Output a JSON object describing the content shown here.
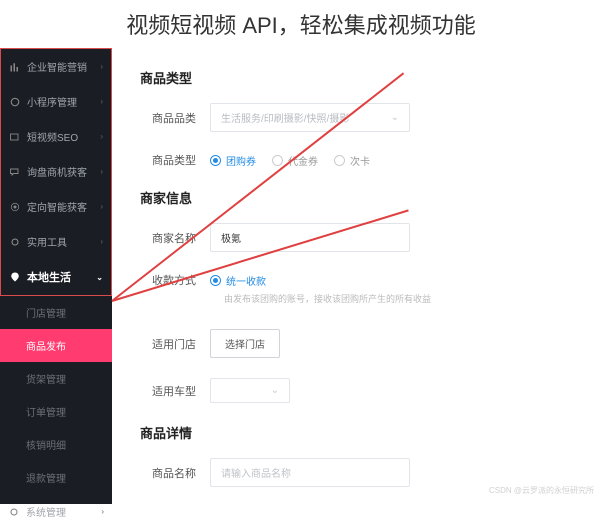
{
  "page_title": "视频短视频 API，轻松集成视频功能",
  "sidebar": {
    "items": [
      {
        "icon": "bars-icon",
        "label": "企业智能营销"
      },
      {
        "icon": "cube-icon",
        "label": "小程序管理"
      },
      {
        "icon": "seo-icon",
        "label": "短视频SEO"
      },
      {
        "icon": "chat-icon",
        "label": "询盘商机获客"
      },
      {
        "icon": "target-icon",
        "label": "定向智能获客"
      },
      {
        "icon": "gear-icon",
        "label": "实用工具"
      },
      {
        "icon": "location-icon",
        "label": "本地生活"
      }
    ],
    "sub_items": [
      "门店管理",
      "商品发布",
      "货架管理",
      "订单管理",
      "核销明细",
      "退款管理"
    ],
    "selected_sub": "商品发布",
    "bottom_item": {
      "icon": "gear-icon",
      "label": "系统管理"
    }
  },
  "sections": {
    "product_type": {
      "title": "商品类型"
    },
    "merchant_info": {
      "title": "商家信息"
    },
    "product_detail": {
      "title": "商品详情"
    }
  },
  "form": {
    "category": {
      "label": "商品品类",
      "placeholder": "生活服务/印刷摄影/快照/摄影"
    },
    "product_type": {
      "label": "商品类型",
      "options": [
        "团购券",
        "代金券",
        "次卡"
      ],
      "selected": "团购券"
    },
    "merchant_name": {
      "label": "商家名称",
      "value": "极氪"
    },
    "payment": {
      "label": "收款方式",
      "options": [
        "统一收款"
      ],
      "selected": "统一收款",
      "helper": "由发布该团购的账号，接收该团购所产生的所有收益"
    },
    "store": {
      "label": "适用门店",
      "button": "选择门店"
    },
    "car_type": {
      "label": "适用车型"
    },
    "product_name": {
      "label": "商品名称",
      "placeholder": "请输入商品名称"
    }
  },
  "watermark": "CSDN @云罗派的永恒研究所"
}
